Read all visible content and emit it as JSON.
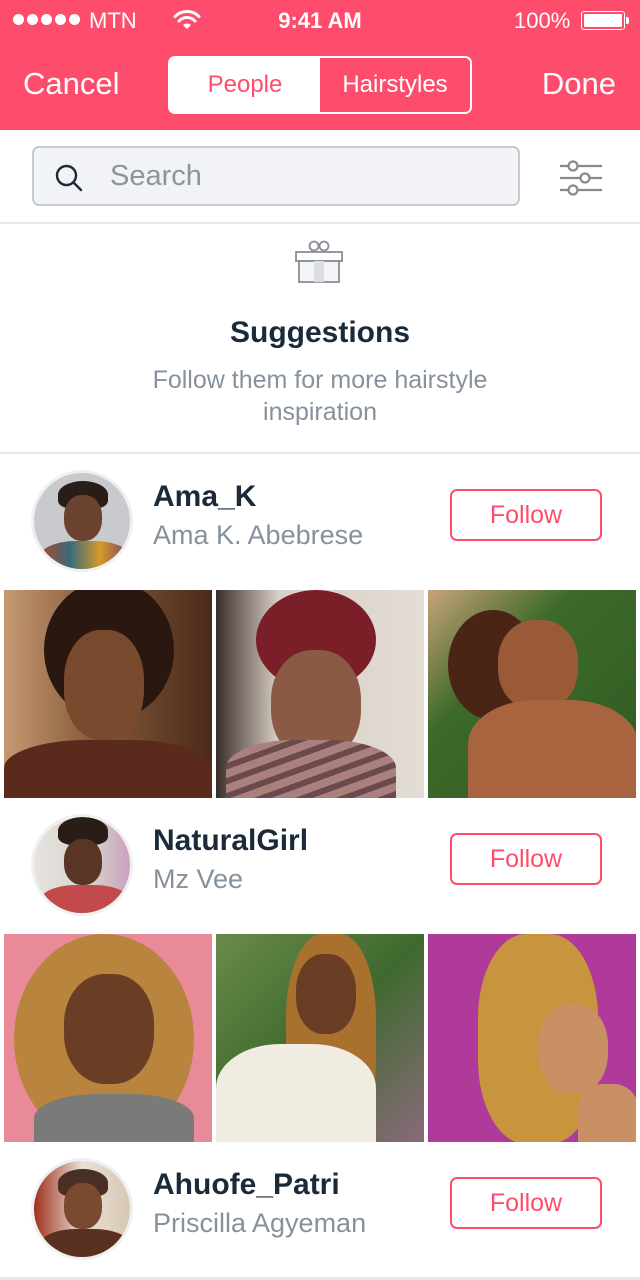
{
  "status_bar": {
    "carrier": "MTN",
    "signal_bars": 5,
    "time": "9:41 AM",
    "battery_percent": "100%",
    "battery_level": 1.0
  },
  "nav": {
    "cancel_label": "Cancel",
    "done_label": "Done",
    "segments": [
      {
        "label": "People",
        "selected": true
      },
      {
        "label": "Hairstyles",
        "selected": false
      }
    ]
  },
  "search": {
    "placeholder": "Search",
    "value": "",
    "filter_icon": "sliders-icon"
  },
  "suggestions": {
    "icon": "gift-icon",
    "title": "Suggestions",
    "subtitle": "Follow them for more hairstyle inspiration"
  },
  "users": [
    {
      "username": "Ama_K",
      "full_name": "Ama K. Abebrese",
      "follow_label": "Follow",
      "photos": [
        {
          "description": "woman with natural afro, warm window light"
        },
        {
          "description": "woman with red tapered afro"
        },
        {
          "description": "woman laughing with short afro, green background"
        }
      ]
    },
    {
      "username": "NaturalGirl",
      "full_name": "Mz Vee",
      "follow_label": "Follow",
      "photos": [
        {
          "description": "woman with honey blonde curly locs, pink background"
        },
        {
          "description": "woman with long honey locs, white sweater"
        },
        {
          "description": "woman with blonde locs ponytail, purple background"
        }
      ]
    },
    {
      "username": "Ahuofe_Patri",
      "full_name": "Priscilla Agyeman",
      "follow_label": "Follow",
      "photos": []
    }
  ],
  "colors": {
    "accent": "#fe4d6c",
    "title_text": "#1b2a3a",
    "secondary_text": "#86919c",
    "divider": "#e6e8eb"
  }
}
